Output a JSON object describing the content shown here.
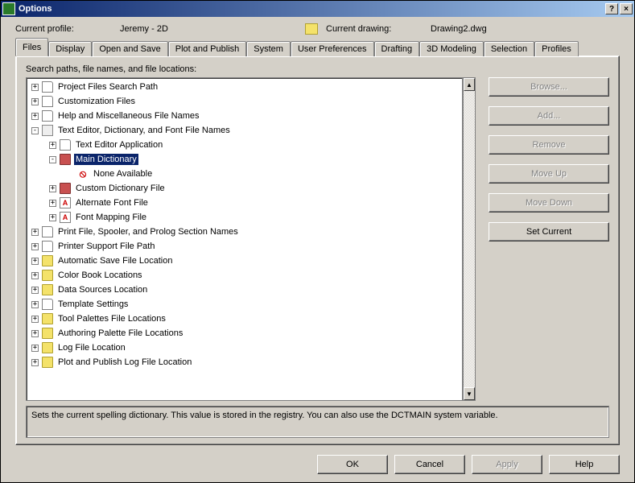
{
  "window": {
    "title": "Options"
  },
  "profile": {
    "label": "Current profile:",
    "value": "Jeremy - 2D",
    "drawing_label": "Current drawing:",
    "drawing_value": "Drawing2.dwg"
  },
  "tabs": [
    {
      "label": "Files",
      "active": true
    },
    {
      "label": "Display"
    },
    {
      "label": "Open and Save"
    },
    {
      "label": "Plot and Publish"
    },
    {
      "label": "System"
    },
    {
      "label": "User Preferences"
    },
    {
      "label": "Drafting"
    },
    {
      "label": "3D Modeling"
    },
    {
      "label": "Selection"
    },
    {
      "label": "Profiles"
    }
  ],
  "panel": {
    "label": "Search paths, file names, and file locations:",
    "tree": [
      {
        "level": 0,
        "exp": "+",
        "icon": "doc",
        "label": "Project Files Search Path"
      },
      {
        "level": 0,
        "exp": "+",
        "icon": "doc",
        "label": "Customization Files"
      },
      {
        "level": 0,
        "exp": "+",
        "icon": "doc",
        "label": "Help and Miscellaneous File Names"
      },
      {
        "level": 0,
        "exp": "-",
        "icon": "gear",
        "label": "Text Editor, Dictionary, and Font File Names"
      },
      {
        "level": 1,
        "exp": "+",
        "icon": "doc",
        "label": "Text Editor Application"
      },
      {
        "level": 1,
        "exp": "-",
        "icon": "book",
        "label": "Main Dictionary",
        "selected": true
      },
      {
        "level": 2,
        "exp": " ",
        "icon": "noavail",
        "label": "None Available"
      },
      {
        "level": 1,
        "exp": "+",
        "icon": "book",
        "label": "Custom Dictionary File"
      },
      {
        "level": 1,
        "exp": "+",
        "icon": "font",
        "label": "Alternate Font File"
      },
      {
        "level": 1,
        "exp": "+",
        "icon": "font",
        "label": "Font Mapping File"
      },
      {
        "level": 0,
        "exp": "+",
        "icon": "doc",
        "label": "Print File, Spooler, and Prolog Section Names"
      },
      {
        "level": 0,
        "exp": "+",
        "icon": "doc",
        "label": "Printer Support File Path"
      },
      {
        "level": 0,
        "exp": "+",
        "icon": "folder",
        "label": "Automatic Save File Location"
      },
      {
        "level": 0,
        "exp": "+",
        "icon": "folder",
        "label": "Color Book Locations"
      },
      {
        "level": 0,
        "exp": "+",
        "icon": "folder",
        "label": "Data Sources Location"
      },
      {
        "level": 0,
        "exp": "+",
        "icon": "doc",
        "label": "Template Settings"
      },
      {
        "level": 0,
        "exp": "+",
        "icon": "folder",
        "label": "Tool Palettes File Locations"
      },
      {
        "level": 0,
        "exp": "+",
        "icon": "folder",
        "label": "Authoring Palette File Locations"
      },
      {
        "level": 0,
        "exp": "+",
        "icon": "folder",
        "label": "Log File Location"
      },
      {
        "level": 0,
        "exp": "+",
        "icon": "folder",
        "label": "Plot and Publish Log File Location"
      }
    ],
    "hint": "Sets the current spelling dictionary. This value is stored in the registry. You can also use the DCTMAIN system variable."
  },
  "side_buttons": [
    {
      "label": "Browse...",
      "disabled": true
    },
    {
      "label": "Add...",
      "disabled": true
    },
    {
      "label": "Remove",
      "disabled": true
    },
    {
      "label": "Move Up",
      "disabled": true
    },
    {
      "label": "Move Down",
      "disabled": true
    },
    {
      "label": "Set Current",
      "disabled": false
    }
  ],
  "footer": {
    "ok": "OK",
    "cancel": "Cancel",
    "apply": "Apply",
    "help": "Help"
  }
}
